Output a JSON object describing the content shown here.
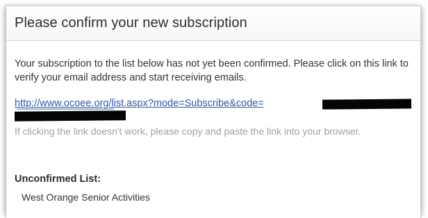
{
  "header": {
    "title": "Please confirm your new subscription"
  },
  "body": {
    "message": "Your subscription to the list below has not yet been confirmed. Please click on this link to verify your email address and start receiving emails.",
    "link_text": "http://www.ocoee.org/list.aspx?mode=Subscribe&code=",
    "hint": "If clicking the link doesn't work, please copy and paste the link into your browser.",
    "unconfirmed_label": "Unconfirmed List:",
    "lists": [
      "West Orange Senior Activities"
    ]
  },
  "colors": {
    "link": "#2a5bb3",
    "hint_text": "#a0a0a0",
    "redaction": "#050505"
  }
}
